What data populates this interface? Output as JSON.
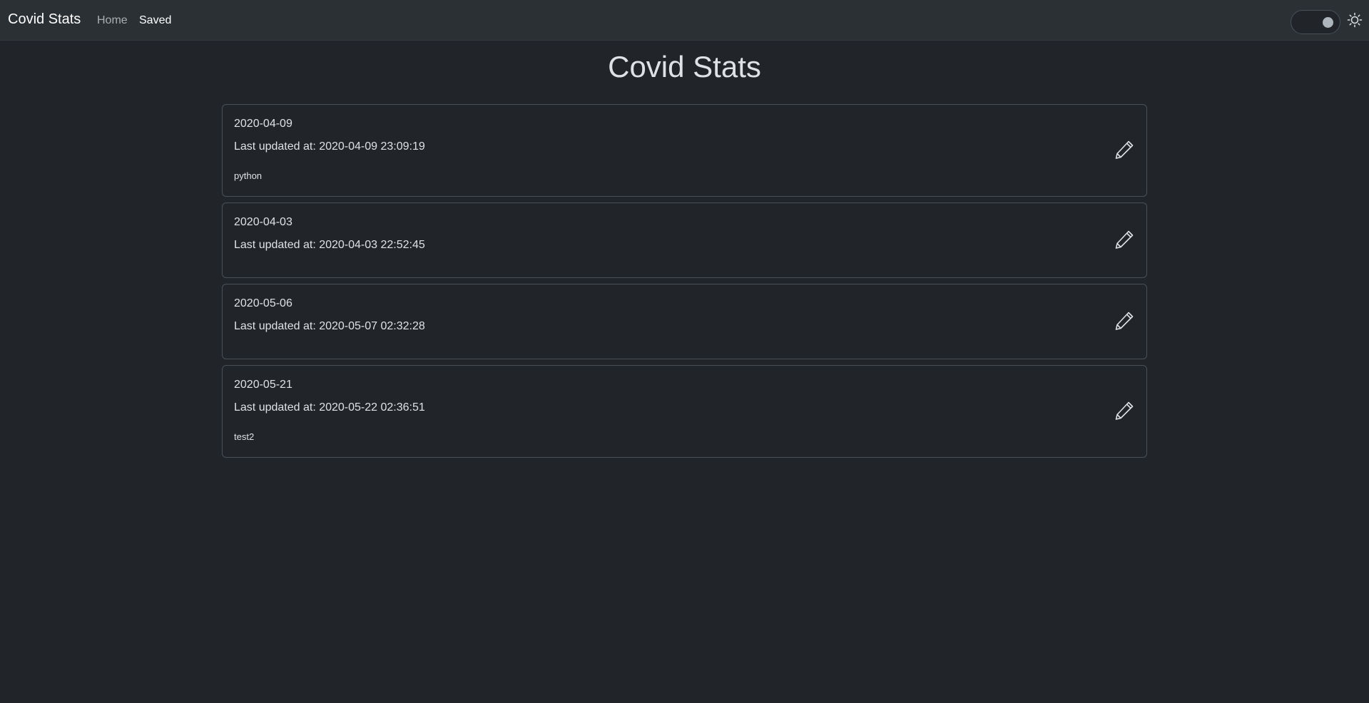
{
  "navbar": {
    "brand": "Covid Stats",
    "links": [
      "Home",
      "Saved"
    ],
    "active_link": "Saved",
    "theme_toggle": {
      "state": "dark",
      "icon": "sun-icon"
    }
  },
  "page": {
    "title": "Covid Stats"
  },
  "cards": [
    {
      "date": "2020-04-09",
      "updated": "Last updated at: 2020-04-09 23:09:19",
      "note": "python"
    },
    {
      "date": "2020-04-03",
      "updated": "Last updated at: 2020-04-03 22:52:45",
      "note": ""
    },
    {
      "date": "2020-05-06",
      "updated": "Last updated at: 2020-05-07 02:32:28",
      "note": ""
    },
    {
      "date": "2020-05-21",
      "updated": "Last updated at: 2020-05-22 02:36:51",
      "note": "test2"
    }
  ],
  "colors": {
    "background": "#212529",
    "navbar": "#2b3035",
    "border": "#495057",
    "text": "#dee2e6"
  }
}
